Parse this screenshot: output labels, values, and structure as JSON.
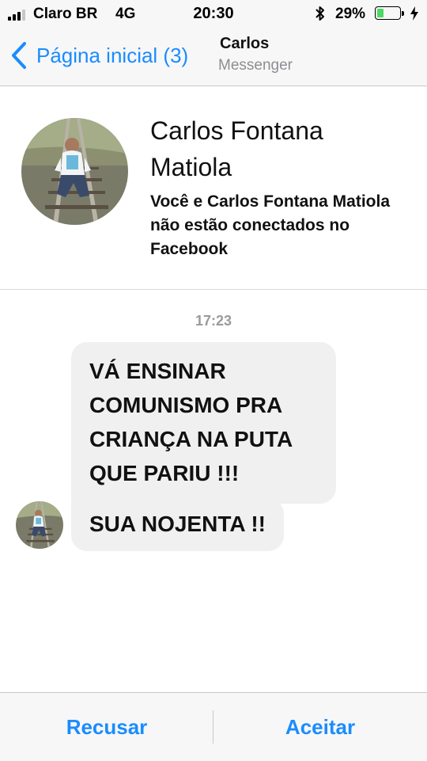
{
  "status_bar": {
    "carrier": "Claro BR",
    "network": "4G",
    "time": "20:30",
    "battery_percent": "29%",
    "battery_level": 0.29,
    "icons": [
      "signal-icon",
      "bluetooth-icon",
      "battery-icon",
      "charging-icon"
    ]
  },
  "nav": {
    "back_label": "Página inicial (3)",
    "title": "Carlos",
    "subtitle": "Messenger"
  },
  "profile": {
    "name": "Carlos Fontana Matiola",
    "info": "Você e Carlos Fontana Matiola não estão conectados no Facebook"
  },
  "conversation": {
    "timestamp": "17:23",
    "messages": [
      {
        "text": "VÁ ENSINAR COMUNISMO PRA CRIANÇA NA PUTA QUE PARIU !!!"
      },
      {
        "text": "SUA NOJENTA !!"
      }
    ]
  },
  "actions": {
    "decline": "Recusar",
    "accept": "Aceitar"
  },
  "colors": {
    "accent": "#1a8cff",
    "bubble": "#f1f0f0",
    "battery_fill": "#4cd964"
  }
}
